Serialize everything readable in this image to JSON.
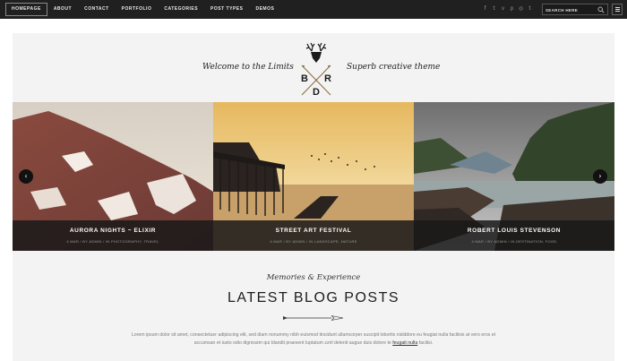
{
  "nav": {
    "items": [
      {
        "label": "HOMEPAGE",
        "active": true
      },
      {
        "label": "ABOUT"
      },
      {
        "label": "CONTACT"
      },
      {
        "label": "PORTFOLIO"
      },
      {
        "label": "CATEGORIES"
      },
      {
        "label": "POST TYPES"
      },
      {
        "label": "DEMOS"
      }
    ],
    "social_icons": [
      "facebook-icon",
      "twitter-icon",
      "vimeo-icon",
      "pinterest-icon",
      "dribbble-icon",
      "tumblr-icon"
    ],
    "search": {
      "placeholder": "SEARCH HERE"
    },
    "menu_icon": "hamburger-icon"
  },
  "hero": {
    "welcome": "Welcome to the Limits",
    "tagline": "Superb creative theme",
    "logo": {
      "letters": [
        "B",
        "R",
        "D"
      ],
      "emblem": "deer-icon"
    }
  },
  "slider": {
    "slides": [
      {
        "title": "AURORA NIGHTS ~ ELIXIR",
        "meta": "4 MAR / BY ADMIN / IN PHOTOGRAPHY, TRAVEL"
      },
      {
        "title": "STREET ART FESTIVAL",
        "meta": "4 MAR / BY ADMIN / IN LANDSCAPE, NATURE"
      },
      {
        "title": "ROBERT LOUIS STEVENSON",
        "meta": "4 MAR / BY ADMIN / IN DESTINATION, FOOD"
      }
    ],
    "prev_icon": "chevron-left-icon",
    "next_icon": "chevron-right-icon"
  },
  "blog": {
    "kicker": "Memories & Experience",
    "title": "LATEST BLOG POSTS",
    "lead_before": "Lorem ipsum dolor sit amet, consectetuer adipiscing elit, sed diam nonummy nibh euismod tincidunt ullamcorper suscipit lobortis nislddore eu feugiat nulla facilisis at vero eros et accumsan et iusto odio dignissim qui blandit praesent luptatum zzril delenit augue duis dolore te ",
    "lead_link": "feugait nulla",
    "lead_after": " facilisi."
  },
  "colors": {
    "topbar": "#202020",
    "content_bg": "#f3f3f3",
    "caption_bg": "#191919"
  }
}
